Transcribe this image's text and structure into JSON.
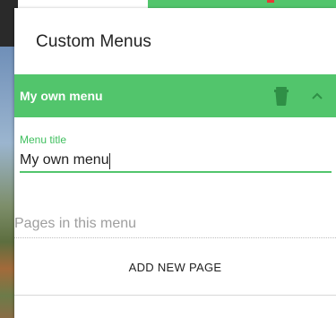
{
  "panel": {
    "title": "Custom Menus"
  },
  "menu": {
    "header_label": "My own menu",
    "field_label": "Menu title",
    "field_value": "My own menu"
  },
  "pages_section": {
    "label": "Pages in this menu",
    "add_button_label": "ADD NEW PAGE"
  },
  "colors": {
    "accent": "#52c56c",
    "accent_text": "#3fbf5e",
    "muted_text": "#9e9e9e",
    "trash_icon": "#2f8f46"
  },
  "icons": {
    "delete": "trash-icon",
    "collapse": "chevron-up-icon"
  }
}
